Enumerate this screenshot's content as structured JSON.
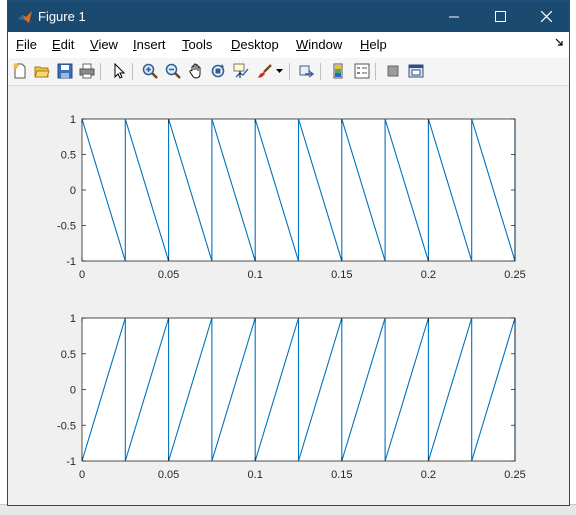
{
  "window": {
    "title": "Figure 1"
  },
  "menu": {
    "items": [
      {
        "label": "File",
        "mnemonic": "F",
        "rest": "ile"
      },
      {
        "label": "Edit",
        "mnemonic": "E",
        "rest": "dit"
      },
      {
        "label": "View",
        "mnemonic": "V",
        "rest": "iew"
      },
      {
        "label": "Insert",
        "mnemonic": "I",
        "rest": "nsert"
      },
      {
        "label": "Tools",
        "mnemonic": "T",
        "rest": "ools"
      },
      {
        "label": "Desktop",
        "mnemonic": "D",
        "rest": "esktop"
      },
      {
        "label": "Window",
        "mnemonic": "W",
        "rest": "indow"
      },
      {
        "label": "Help",
        "mnemonic": "H",
        "rest": "elp"
      }
    ]
  },
  "toolbar": {
    "icons": [
      "new-figure-icon",
      "open-file-icon",
      "save-icon",
      "print-icon",
      "pointer-icon",
      "zoom-in-icon",
      "zoom-out-icon",
      "pan-hand-icon",
      "rotate-3d-icon",
      "data-cursor-icon",
      "brush-icon",
      "brush-dropdown-icon",
      "link-plot-icon",
      "insert-colorbar-icon",
      "insert-legend-icon",
      "hide-plot-tools-icon",
      "show-plot-tools-icon"
    ]
  },
  "colors": {
    "line": "#0072bd",
    "titlebar": "#1b4a70"
  },
  "chart_data": [
    {
      "type": "line",
      "title": "",
      "xlabel": "",
      "ylabel": "",
      "xlim": [
        0,
        0.25
      ],
      "ylim": [
        -1,
        1
      ],
      "x_ticks": [
        "0",
        "0.05",
        "0.1",
        "0.15",
        "0.2",
        "0.25"
      ],
      "y_ticks": [
        "1",
        "0.5",
        "0",
        "-0.5",
        "-1"
      ],
      "series": [
        {
          "x": [
            0,
            0.025,
            0.025,
            0.05,
            0.05,
            0.075,
            0.075,
            0.1,
            0.1,
            0.125,
            0.125,
            0.15,
            0.15,
            0.175,
            0.175,
            0.2,
            0.2,
            0.225,
            0.225,
            0.25,
            0.25
          ],
          "y": [
            1,
            -1,
            1,
            -1,
            1,
            -1,
            1,
            -1,
            1,
            -1,
            1,
            -1,
            1,
            -1,
            1,
            -1,
            1,
            -1,
            1,
            -1,
            1
          ]
        }
      ]
    },
    {
      "type": "line",
      "title": "",
      "xlabel": "",
      "ylabel": "",
      "xlim": [
        0,
        0.25
      ],
      "ylim": [
        -1,
        1
      ],
      "x_ticks": [
        "0",
        "0.05",
        "0.1",
        "0.15",
        "0.2",
        "0.25"
      ],
      "y_ticks": [
        "1",
        "0.5",
        "0",
        "-0.5",
        "-1"
      ],
      "series": [
        {
          "x": [
            0,
            0.025,
            0.025,
            0.05,
            0.05,
            0.075,
            0.075,
            0.1,
            0.1,
            0.125,
            0.125,
            0.15,
            0.15,
            0.175,
            0.175,
            0.2,
            0.2,
            0.225,
            0.225,
            0.25,
            0.25
          ],
          "y": [
            -1,
            1,
            -1,
            1,
            -1,
            1,
            -1,
            1,
            -1,
            1,
            -1,
            1,
            -1,
            1,
            -1,
            1,
            -1,
            1,
            -1,
            1,
            -1
          ]
        }
      ]
    }
  ]
}
